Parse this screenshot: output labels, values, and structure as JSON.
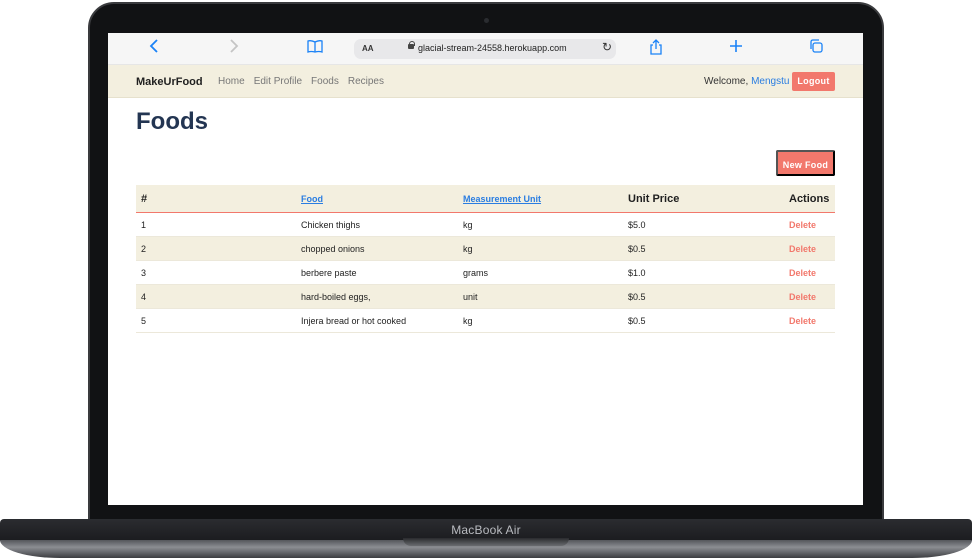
{
  "browser": {
    "url": "glacial-stream-24558.herokuapp.com",
    "reader_label": "AA"
  },
  "device": {
    "label": "MacBook Air"
  },
  "navbar": {
    "brand": "MakeUrFood",
    "links": [
      "Home",
      "Edit Profile",
      "Foods",
      "Recipes"
    ],
    "welcome_prefix": "Welcome,",
    "username": "Mengstu",
    "logout_label": "Logout"
  },
  "page": {
    "title": "Foods",
    "new_button": "New Food"
  },
  "table": {
    "headers": [
      "#",
      "Food",
      "Measurement Unit",
      "Unit Price",
      "Actions"
    ],
    "rows": [
      {
        "num": "1",
        "food": "Chicken thighs",
        "unit": "kg",
        "price": "$5.0",
        "action": "Delete"
      },
      {
        "num": "2",
        "food": "chopped onions",
        "unit": "kg",
        "price": "$0.5",
        "action": "Delete"
      },
      {
        "num": "3",
        "food": "berbere paste",
        "unit": "grams",
        "price": "$1.0",
        "action": "Delete"
      },
      {
        "num": "4",
        "food": "hard-boiled eggs,",
        "unit": "unit",
        "price": "$0.5",
        "action": "Delete"
      },
      {
        "num": "5",
        "food": "Injera bread or hot cooked",
        "unit": "kg",
        "price": "$0.5",
        "action": "Delete"
      }
    ]
  },
  "colors": {
    "accent": "#f2786c",
    "navbar_bg": "#f3efdf",
    "title": "#233552",
    "link": "#2a7de1"
  }
}
